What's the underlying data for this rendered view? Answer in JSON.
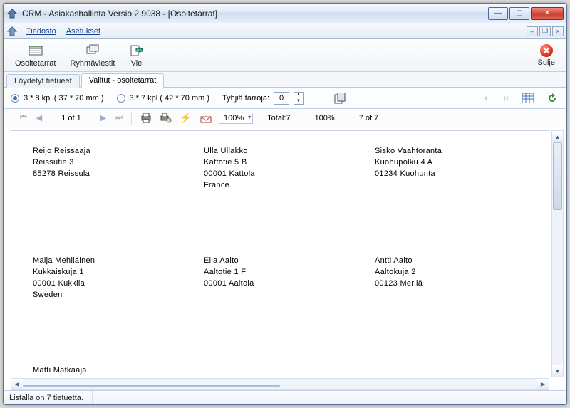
{
  "window": {
    "title": "CRM - Asiakashallinta Versio 2.9038 - [Osoitetarrat]"
  },
  "menu": {
    "file": "Tiedosto",
    "settings": "Asetukset"
  },
  "toolbar": {
    "labels": "Osoitetarrat",
    "groupmsg": "Ryhmäviestit",
    "export": "Vie",
    "close": "Sulje"
  },
  "tabs": {
    "found": "Löydetyt tietueet",
    "selected": "Valitut - osoitetarrat"
  },
  "options": {
    "fmt1": "3 * 8  kpl ( 37 * 70 mm )",
    "fmt2": "3 * 7  kpl ( 42 * 70 mm )",
    "empty_label": "Tyhjiä tarroja:",
    "empty_value": "0"
  },
  "reportbar": {
    "pageof": "1 of 1",
    "zoom": "100%",
    "total_label": "Total:7",
    "pct": "100%",
    "count": "7 of 7"
  },
  "addresses": [
    {
      "name": "Reijo Reissaaja",
      "l1": "Reissutie 3",
      "l2": "85278 Reissula",
      "l3": ""
    },
    {
      "name": "Ulla Ullakko",
      "l1": "Kattotie 5 B",
      "l2": "00001 Kattola",
      "l3": "France"
    },
    {
      "name": "Sisko Vaahtoranta",
      "l1": "Kuohupolku 4 A",
      "l2": "01234 Kuohunta",
      "l3": ""
    },
    {
      "name": "Maija Mehiläinen",
      "l1": "Kukkaiskuja 1",
      "l2": "00001 Kukkila",
      "l3": "Sweden"
    },
    {
      "name": "Eila Aalto",
      "l1": "Aaltotie 1 F",
      "l2": "00001 Aaltola",
      "l3": ""
    },
    {
      "name": "Antti Aalto",
      "l1": "Aaltokuja 2",
      "l2": "00123 Merilä",
      "l3": ""
    },
    {
      "name": "Matti Matkaaja",
      "l1": "",
      "l2": "",
      "l3": ""
    }
  ],
  "status": {
    "text": "Listalla on 7 tietuetta."
  }
}
